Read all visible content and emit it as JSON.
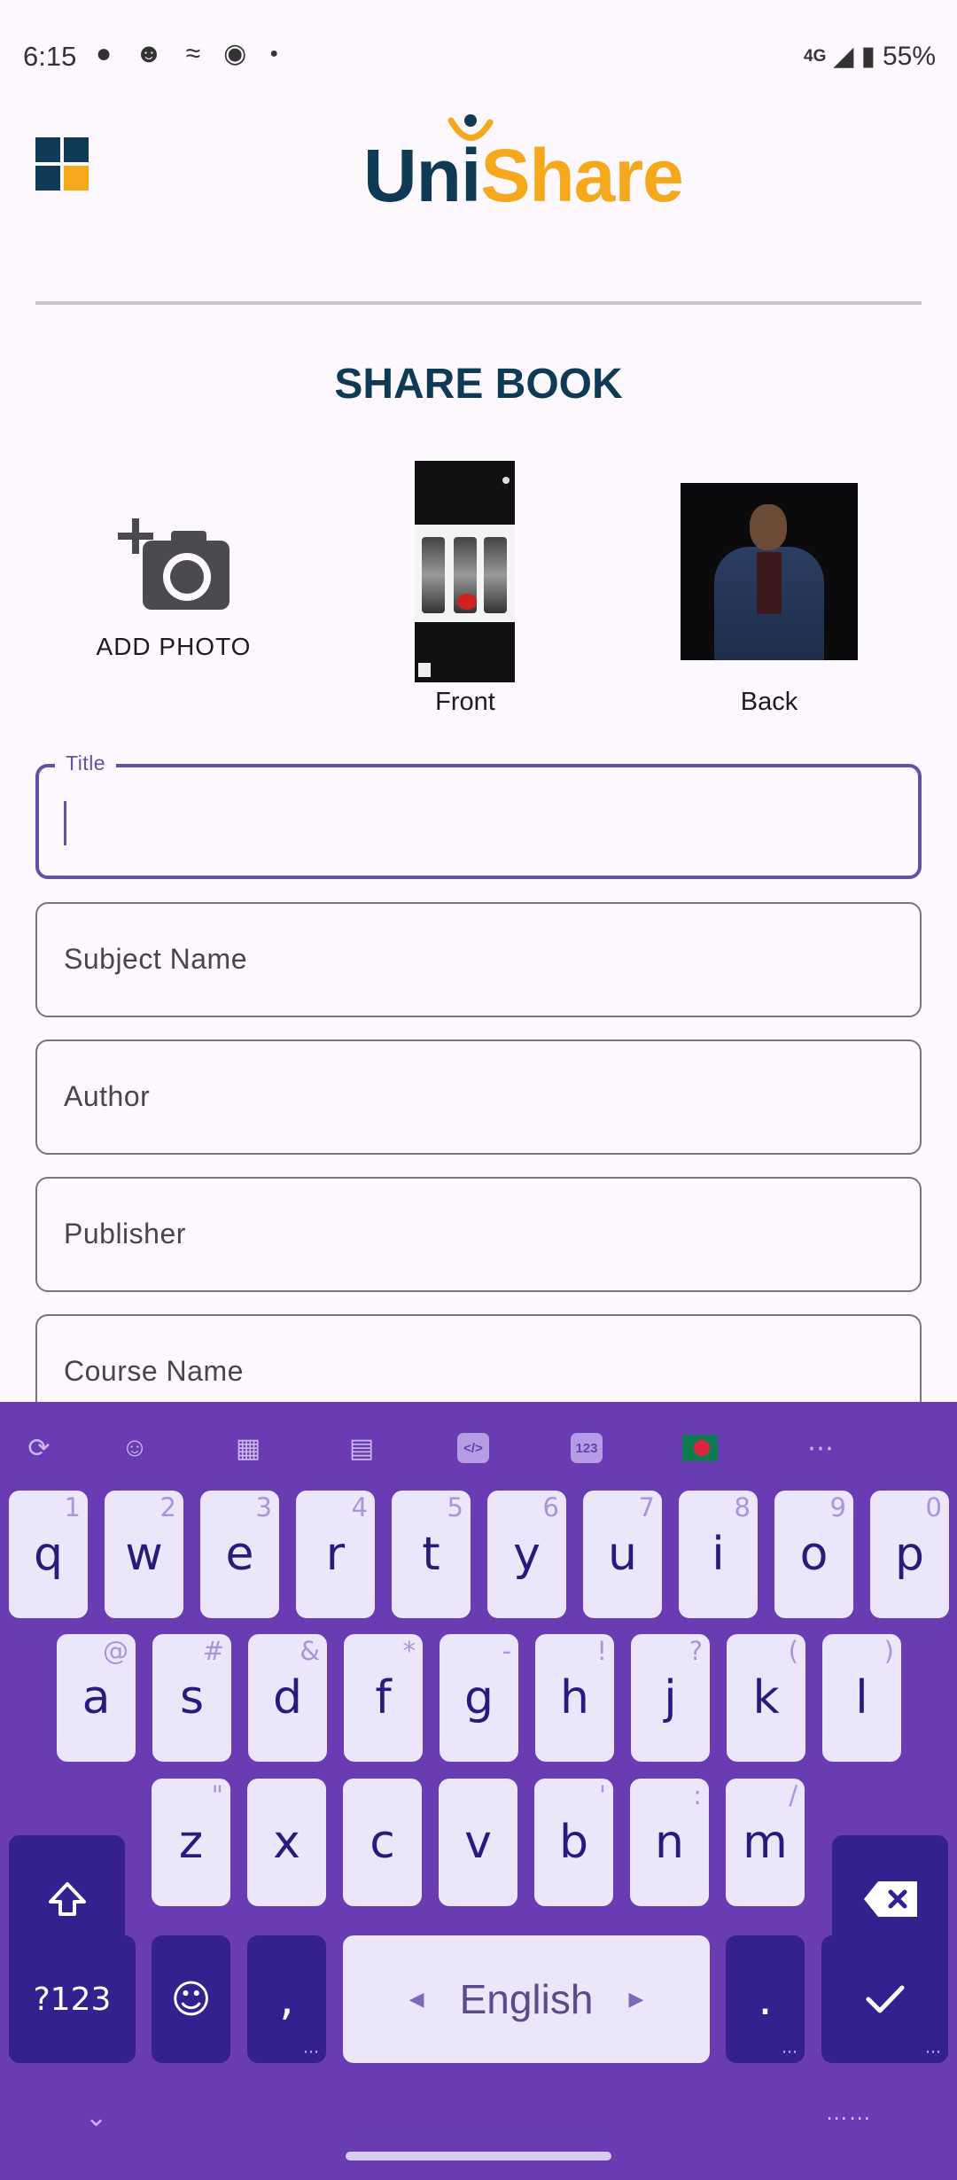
{
  "status_bar": {
    "time": "6:15",
    "network": "4G",
    "battery": "55%",
    "notification_icons": [
      "chat-bubble-icon",
      "notification-icon",
      "app-icon",
      "facebook-icon",
      "more-dot-icon"
    ]
  },
  "header": {
    "logo_left": "Uni",
    "logo_right": "Share",
    "brand_colors": {
      "primary": "#0f3a55",
      "accent": "#f5a81c"
    }
  },
  "page": {
    "title": "SHARE BOOK"
  },
  "photos": {
    "add_label": "ADD PHOTO",
    "front_label": "Front",
    "back_label": "Back"
  },
  "form": {
    "title_label": "Title",
    "title_value": "",
    "subject_label": "Subject Name",
    "author_label": "Author",
    "publisher_label": "Publisher",
    "course_label": "Course Name"
  },
  "keyboard": {
    "accent_color": "#6a3cb4",
    "row1": [
      {
        "key": "q",
        "hint": "1"
      },
      {
        "key": "w",
        "hint": "2"
      },
      {
        "key": "e",
        "hint": "3"
      },
      {
        "key": "r",
        "hint": "4"
      },
      {
        "key": "t",
        "hint": "5"
      },
      {
        "key": "y",
        "hint": "6"
      },
      {
        "key": "u",
        "hint": "7"
      },
      {
        "key": "i",
        "hint": "8"
      },
      {
        "key": "o",
        "hint": "9"
      },
      {
        "key": "p",
        "hint": "0"
      }
    ],
    "row2": [
      {
        "key": "a",
        "hint": "@"
      },
      {
        "key": "s",
        "hint": "#"
      },
      {
        "key": "d",
        "hint": "&"
      },
      {
        "key": "f",
        "hint": "*"
      },
      {
        "key": "g",
        "hint": "-"
      },
      {
        "key": "h",
        "hint": "!"
      },
      {
        "key": "j",
        "hint": "?"
      },
      {
        "key": "k",
        "hint": "("
      },
      {
        "key": "l",
        "hint": ")"
      }
    ],
    "row3": [
      {
        "key": "z",
        "hint": "\""
      },
      {
        "key": "x",
        "hint": ""
      },
      {
        "key": "c",
        "hint": ""
      },
      {
        "key": "v",
        "hint": ""
      },
      {
        "key": "b",
        "hint": "'"
      },
      {
        "key": "n",
        "hint": ":"
      },
      {
        "key": "m",
        "hint": "/"
      }
    ],
    "symbols_key": "?123",
    "comma_key": ",",
    "space_label": "English",
    "period_key": ".",
    "toolbar_icons": [
      "translate-icon",
      "emoji-icon",
      "store-icon",
      "clipboard-icon",
      "code-icon",
      "numpad-icon",
      "language-flag-icon",
      "more-icon"
    ]
  }
}
